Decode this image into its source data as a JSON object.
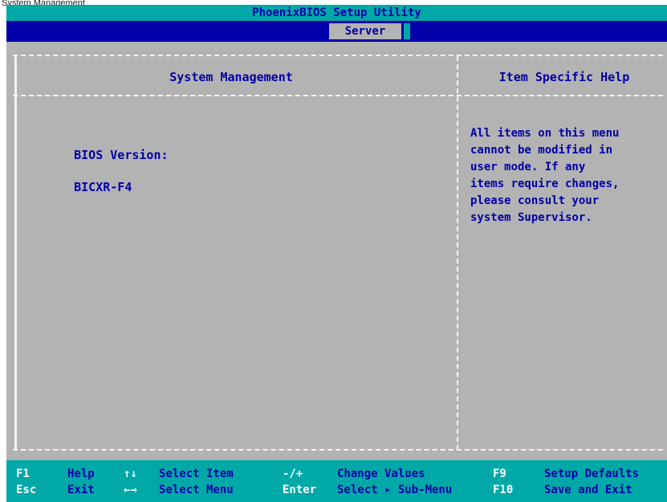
{
  "caption": "System Management",
  "title": "PhoenixBIOS Setup Utility",
  "menu": {
    "active_tab": "Server"
  },
  "left_panel": {
    "heading": "System Management",
    "bios_version_label": "BIOS Version:",
    "bios_version_value": "BICXR-F4"
  },
  "right_panel": {
    "heading": "Item Specific Help",
    "help_lines": [
      "All items on this menu",
      "cannot be modified in",
      "user mode.  If any",
      "items require changes,",
      "please consult your",
      "system Supervisor."
    ]
  },
  "footer": {
    "row1": [
      {
        "key": "F1",
        "label": "Help"
      },
      {
        "key": "↑↓",
        "label": "Select Item"
      },
      {
        "key": "-/+",
        "label": "Change Values"
      },
      {
        "key": "F9",
        "label": "Setup Defaults"
      }
    ],
    "row2": [
      {
        "key": "Esc",
        "label": "Exit"
      },
      {
        "key": "←→",
        "label": "Select Menu"
      },
      {
        "key": "Enter",
        "label": "Select ▸ Sub-Menu"
      },
      {
        "key": "F10",
        "label": "Save and Exit"
      }
    ]
  },
  "colors": {
    "background": "#b3b3b3",
    "title_bar": "#00a8a8",
    "menu_bar": "#0000a8",
    "text": "#0000a8",
    "key_text": "#ffffff"
  }
}
